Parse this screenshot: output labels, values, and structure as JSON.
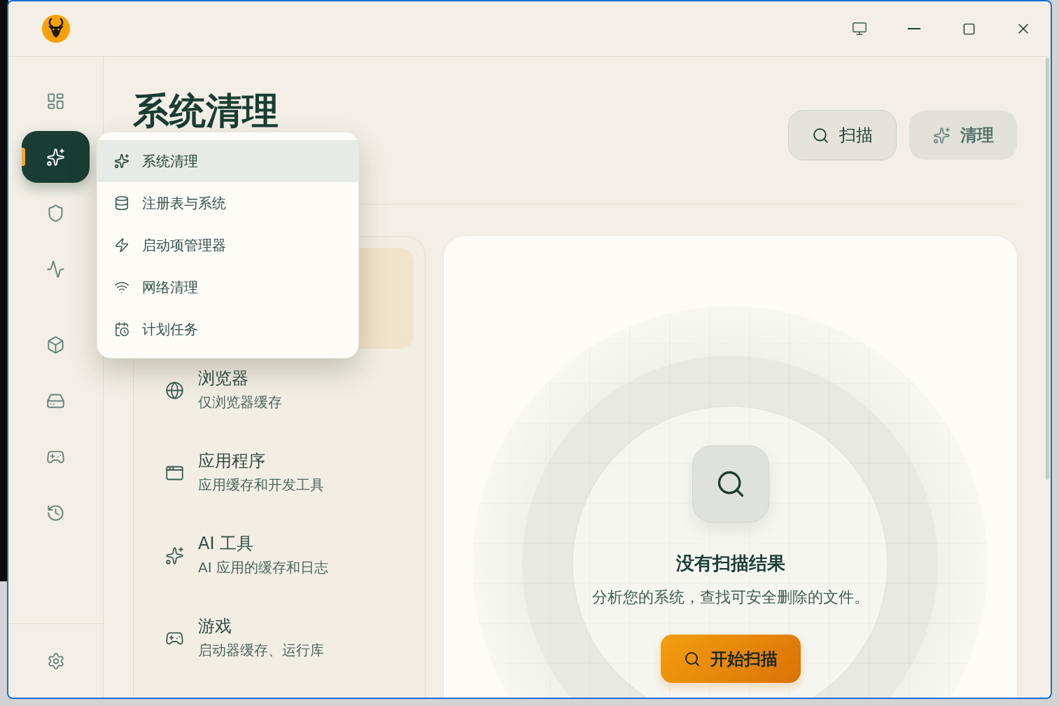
{
  "sidebar": {
    "sections": [
      {
        "items": [
          {
            "selected": false
          },
          {
            "selected": true
          },
          {
            "selected": false
          },
          {
            "selected": false
          }
        ]
      },
      {
        "items": [
          {
            "selected": false
          },
          {
            "selected": false
          },
          {
            "selected": false
          },
          {
            "selected": false
          }
        ]
      }
    ]
  },
  "page": {
    "title": "系统清理",
    "actions": [
      {
        "label": "扫描",
        "disabled": false
      },
      {
        "label": "清理",
        "disabled": true
      }
    ]
  },
  "menu": {
    "items": [
      {
        "label": "系统清理",
        "selected": true
      },
      {
        "label": "注册表与系统",
        "selected": false
      },
      {
        "label": "启动项管理器",
        "selected": false
      },
      {
        "label": "网络清理",
        "selected": false
      },
      {
        "label": "计划任务",
        "selected": false
      }
    ]
  },
  "categories": [
    {
      "selected": true
    },
    {
      "title": "浏览器",
      "description": "仅浏览器缓存",
      "selected": false
    },
    {
      "title": "应用程序",
      "description": "应用缓存和开发工具",
      "selected": false
    },
    {
      "title": "AI 工具",
      "description": "AI 应用的缓存和日志",
      "selected": false
    },
    {
      "title": "游戏",
      "description": "启动器缓存、运行库",
      "selected": false
    }
  ],
  "empty_state": {
    "title": "没有扫描结果",
    "description": "分析您的系统，查找可安全删除的文件。",
    "button": "开始扫描"
  }
}
